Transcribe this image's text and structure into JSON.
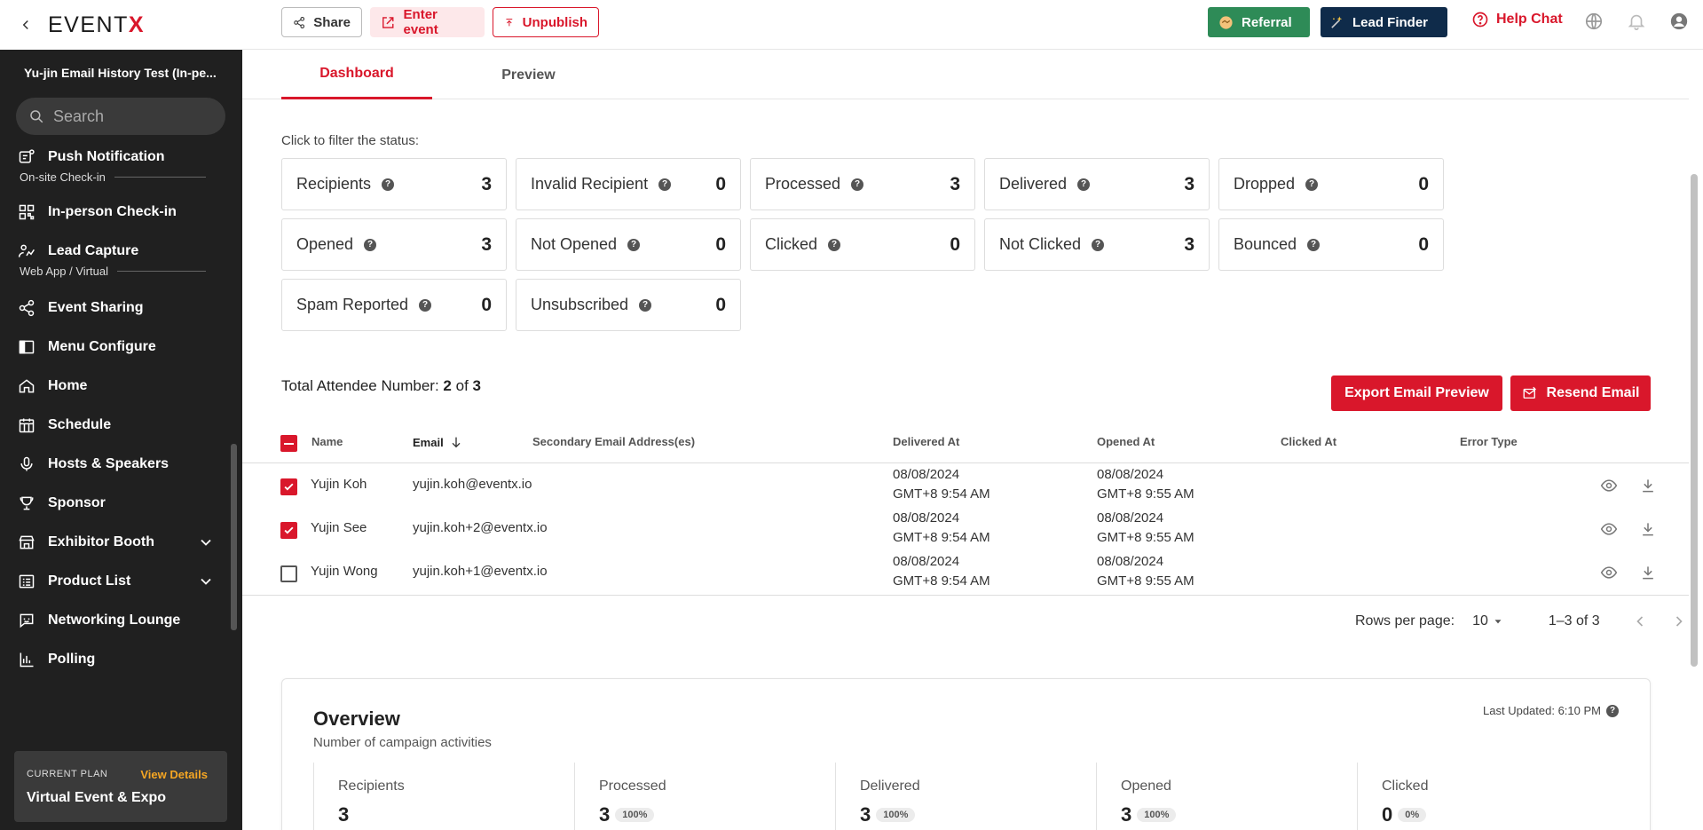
{
  "app": {
    "logo_prefix": "EVENT",
    "logo_suffix": "X"
  },
  "sidebar": {
    "event_title": "Yu-jin Email History Test (In-pe...",
    "search_placeholder": "Search",
    "items": [
      {
        "label": "Push Notification",
        "icon": "push-notification-icon"
      },
      {
        "label": "In-person Check-in",
        "icon": "qr-code-icon"
      },
      {
        "label": "Lead Capture",
        "icon": "lead-capture-icon"
      },
      {
        "label": "Event Sharing",
        "icon": "share-icon"
      },
      {
        "label": "Menu Configure",
        "icon": "layout-icon"
      },
      {
        "label": "Home",
        "icon": "home-icon"
      },
      {
        "label": "Schedule",
        "icon": "calendar-icon"
      },
      {
        "label": "Hosts & Speakers",
        "icon": "microphone-icon"
      },
      {
        "label": "Sponsor",
        "icon": "sponsor-icon"
      },
      {
        "label": "Exhibitor Booth",
        "icon": "booth-icon"
      },
      {
        "label": "Product List",
        "icon": "list-icon"
      },
      {
        "label": "Networking Lounge",
        "icon": "chat-icon"
      },
      {
        "label": "Polling",
        "icon": "bar-chart-icon"
      }
    ],
    "sections": {
      "onsite": "On-site Check-in",
      "webapp": "Web App / Virtual"
    },
    "plan": {
      "label": "CURRENT PLAN",
      "link": "View Details",
      "name": "Virtual Event & Expo"
    }
  },
  "topbar": {
    "share": "Share",
    "enter_event": "Enter event",
    "unpublish": "Unpublish",
    "referral": "Referral",
    "lead_finder": "Lead Finder",
    "help_chat": "Help Chat"
  },
  "tabs": {
    "dashboard": "Dashboard",
    "preview": "Preview"
  },
  "filter_label": "Click to filter the status:",
  "stats": [
    {
      "label": "Recipients",
      "value": "3"
    },
    {
      "label": "Invalid Recipient",
      "value": "0"
    },
    {
      "label": "Processed",
      "value": "3"
    },
    {
      "label": "Delivered",
      "value": "3"
    },
    {
      "label": "Dropped",
      "value": "0"
    },
    {
      "label": "Opened",
      "value": "3"
    },
    {
      "label": "Not Opened",
      "value": "0"
    },
    {
      "label": "Clicked",
      "value": "0"
    },
    {
      "label": "Not Clicked",
      "value": "3"
    },
    {
      "label": "Bounced",
      "value": "0"
    },
    {
      "label": "Spam Reported",
      "value": "0"
    },
    {
      "label": "Unsubscribed",
      "value": "0"
    }
  ],
  "attendees": {
    "total_label": "Total Attendee Number:",
    "selected": "2",
    "of": "of",
    "total": "3",
    "export_button": "Export Email Preview",
    "resend_button": "Resend Email",
    "columns": {
      "name": "Name",
      "email": "Email",
      "secondary": "Secondary Email Address(es)",
      "delivered": "Delivered At",
      "opened": "Opened At",
      "clicked": "Clicked At",
      "error": "Error Type"
    },
    "rows": [
      {
        "checked": true,
        "name": "Yujin Koh",
        "email": "yujin.koh@eventx.io",
        "delivered_date": "08/08/2024",
        "delivered_time": "GMT+8 9:54 AM",
        "opened_date": "08/08/2024",
        "opened_time": "GMT+8 9:55 AM"
      },
      {
        "checked": true,
        "name": "Yujin See",
        "email": "yujin.koh+2@eventx.io",
        "delivered_date": "08/08/2024",
        "delivered_time": "GMT+8 9:54 AM",
        "opened_date": "08/08/2024",
        "opened_time": "GMT+8 9:55 AM"
      },
      {
        "checked": false,
        "name": "Yujin Wong",
        "email": "yujin.koh+1@eventx.io",
        "delivered_date": "08/08/2024",
        "delivered_time": "GMT+8 9:54 AM",
        "opened_date": "08/08/2024",
        "opened_time": "GMT+8 9:55 AM"
      }
    ],
    "pagination": {
      "rows_per_page_label": "Rows per page:",
      "rows_per_page": "10",
      "range": "1–3 of 3"
    }
  },
  "overview": {
    "title": "Overview",
    "subtitle": "Number of campaign activities",
    "last_updated": "Last Updated: 6:10 PM",
    "cards": [
      {
        "label": "Recipients",
        "value": "3",
        "pct": ""
      },
      {
        "label": "Processed",
        "value": "3",
        "pct": "100%"
      },
      {
        "label": "Delivered",
        "value": "3",
        "pct": "100%"
      },
      {
        "label": "Opened",
        "value": "3",
        "pct": "100%"
      },
      {
        "label": "Clicked",
        "value": "0",
        "pct": "0%"
      }
    ]
  },
  "colors": {
    "brand_red": "#d9172b",
    "referral_green": "#2e8b57",
    "lead_navy": "#0f2b4a",
    "sidebar_bg": "#202020",
    "plan_link": "#f5a623"
  }
}
